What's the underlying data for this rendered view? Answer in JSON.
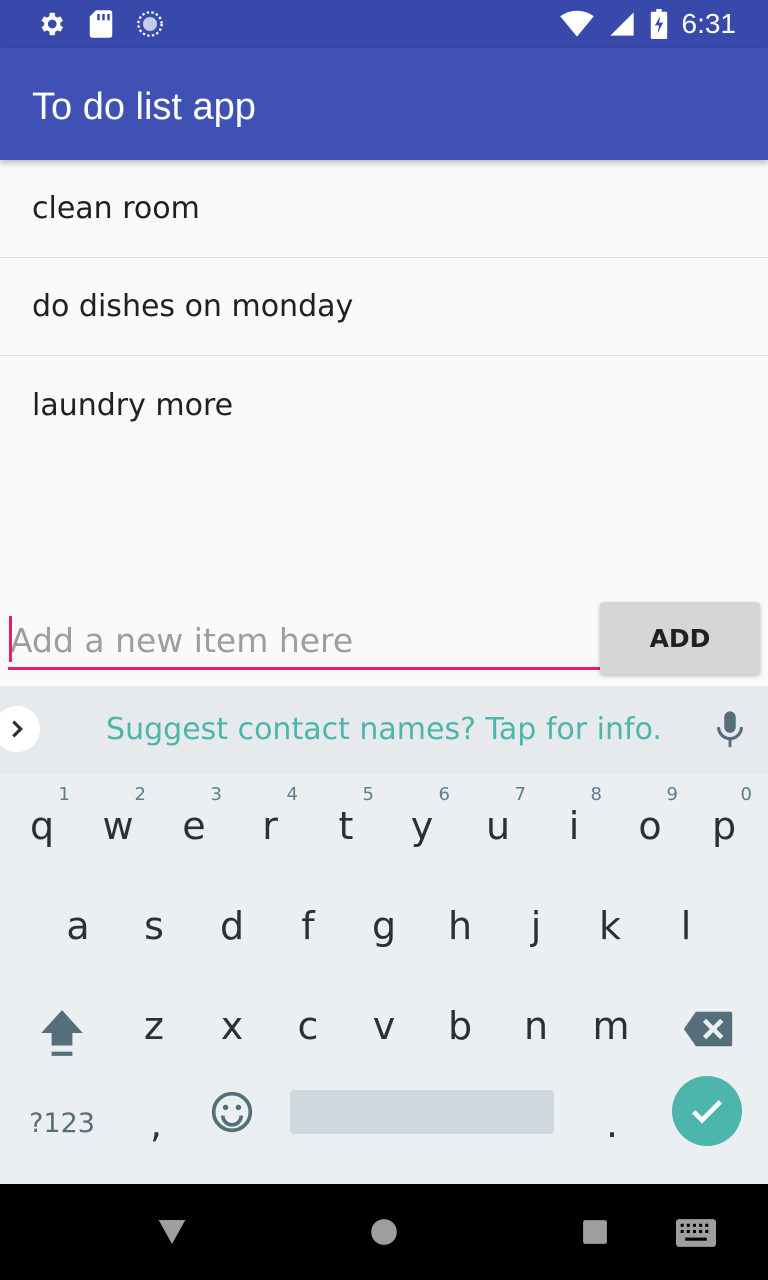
{
  "status_bar": {
    "time": "6:31",
    "left_icons": [
      "gear-icon",
      "sd-card-icon",
      "sync-circle-icon"
    ],
    "right_icons": [
      "wifi-icon",
      "signal-icon",
      "battery-charging-icon"
    ]
  },
  "app_bar": {
    "title": "To do list app"
  },
  "todo_list": {
    "items": [
      {
        "label": "clean room"
      },
      {
        "label": "do dishes on monday"
      },
      {
        "label": "laundry more"
      }
    ]
  },
  "new_item": {
    "placeholder": "Add a new item here",
    "value": "",
    "add_label": "ADD"
  },
  "keyboard": {
    "suggestion": "Suggest contact names? Tap for info.",
    "row1": [
      {
        "key": "q",
        "hint": "1"
      },
      {
        "key": "w",
        "hint": "2"
      },
      {
        "key": "e",
        "hint": "3"
      },
      {
        "key": "r",
        "hint": "4"
      },
      {
        "key": "t",
        "hint": "5"
      },
      {
        "key": "y",
        "hint": "6"
      },
      {
        "key": "u",
        "hint": "7"
      },
      {
        "key": "i",
        "hint": "8"
      },
      {
        "key": "o",
        "hint": "9"
      },
      {
        "key": "p",
        "hint": "0"
      }
    ],
    "row2": [
      "a",
      "s",
      "d",
      "f",
      "g",
      "h",
      "j",
      "k",
      "l"
    ],
    "row3": [
      "z",
      "x",
      "c",
      "v",
      "b",
      "n",
      "m"
    ],
    "symbols_label": "?123",
    "comma": ",",
    "period": "."
  },
  "colors": {
    "app_bar": "#3f51b5",
    "status_bar": "#3949ab",
    "accent": "#e91e63",
    "keyboard_accent": "#4db6ac"
  }
}
